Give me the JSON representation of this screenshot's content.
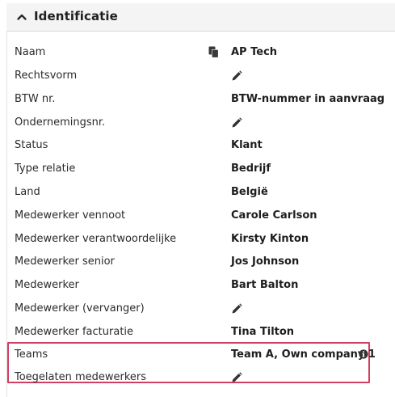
{
  "section": {
    "title": "Identificatie",
    "chevron_icon": "chevron-up-icon"
  },
  "fields": {
    "naam": {
      "label": "Naam",
      "value": "AP Tech",
      "icon": "copy-icon"
    },
    "rechtsvorm": {
      "label": "Rechtsvorm",
      "icon": "pencil-icon"
    },
    "btw": {
      "label": "BTW nr.",
      "value": "BTW-nummer in aanvraag"
    },
    "ondernemingsnr": {
      "label": "Ondernemingsnr.",
      "icon": "pencil-icon"
    },
    "status": {
      "label": "Status",
      "value": "Klant"
    },
    "type_relatie": {
      "label": "Type relatie",
      "value": "Bedrijf"
    },
    "land": {
      "label": "Land",
      "value": "België"
    },
    "medewerker_vennoot": {
      "label": "Medewerker vennoot",
      "value": "Carole Carlson"
    },
    "medewerker_verantwoordelijke": {
      "label": "Medewerker verantwoordelijke",
      "value": "Kirsty Kinton"
    },
    "medewerker_senior": {
      "label": "Medewerker senior",
      "value": "Jos Johnson"
    },
    "medewerker": {
      "label": "Medewerker",
      "value": "Bart Balton"
    },
    "medewerker_vervanger": {
      "label": "Medewerker (vervanger)",
      "icon": "pencil-icon"
    },
    "medewerker_facturatie": {
      "label": "Medewerker facturatie",
      "value": "Tina Tilton"
    },
    "teams": {
      "label": "Teams",
      "value": "Team A, Own company 1",
      "icon": "info-icon"
    },
    "toegelaten_medewerkers": {
      "label": "Toegelaten medewerkers",
      "icon": "pencil-icon"
    }
  },
  "colors": {
    "header_bg": "#f4f4f4",
    "highlight_border": "#d23f63",
    "icon": "#333333"
  }
}
